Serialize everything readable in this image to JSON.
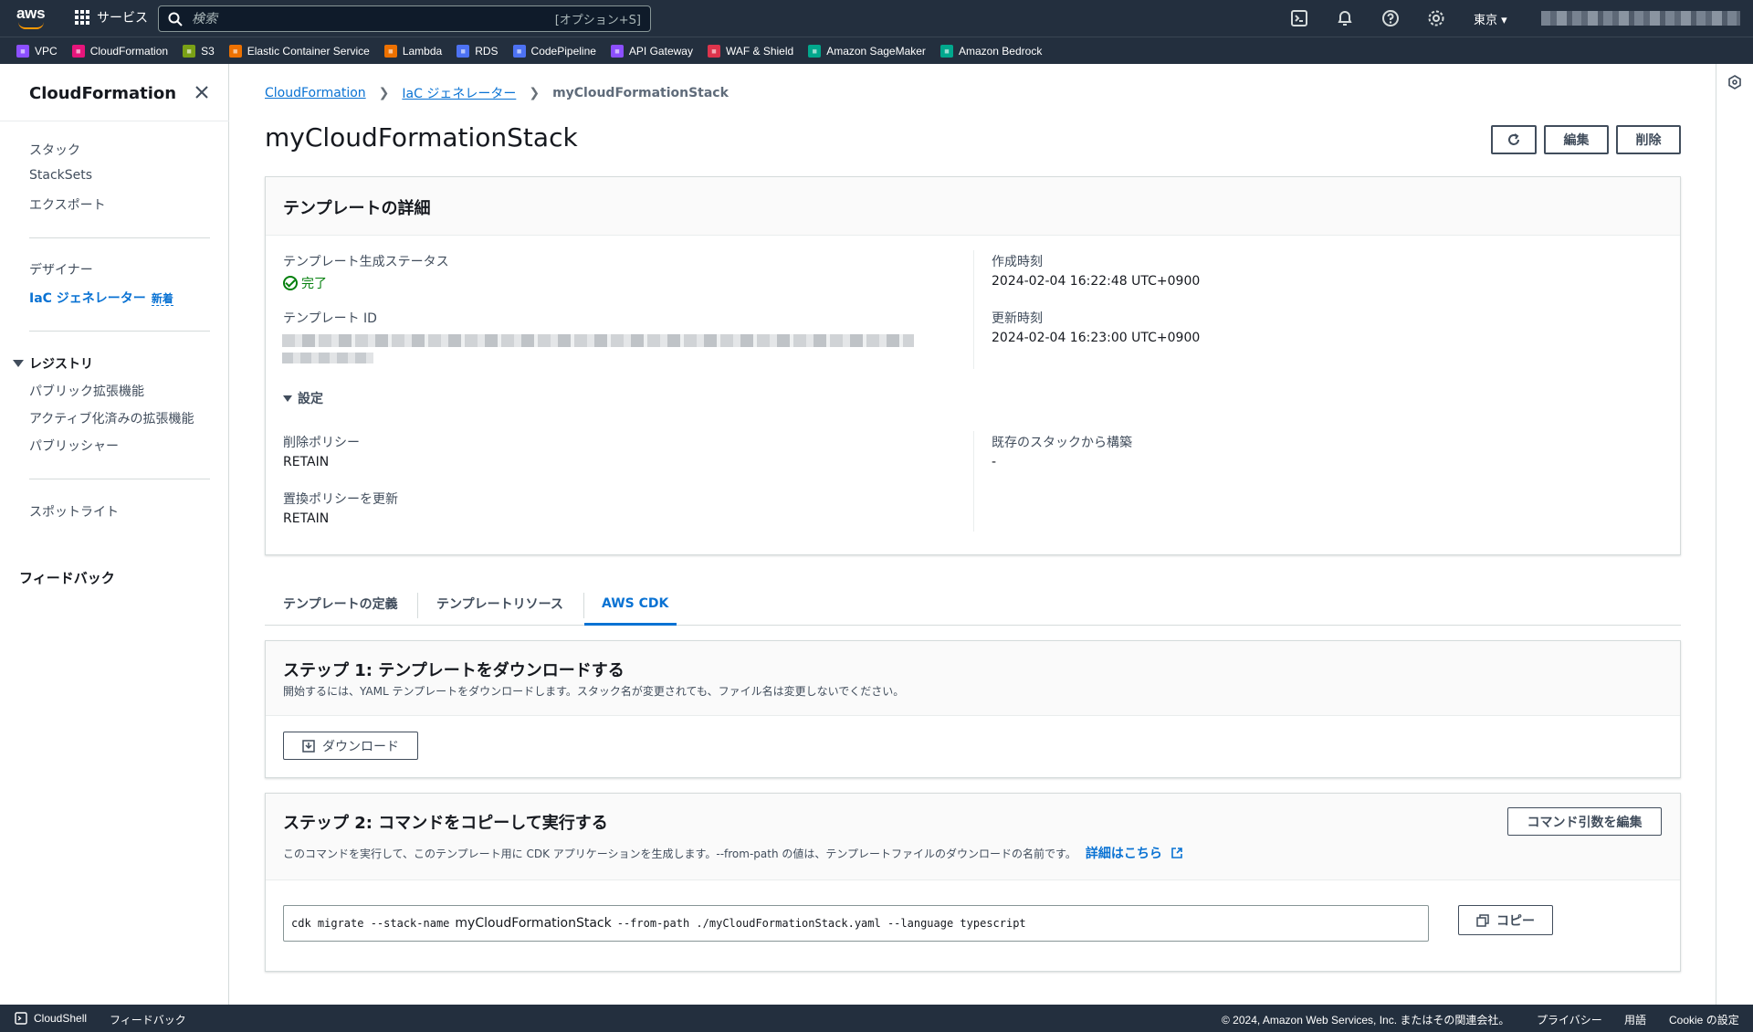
{
  "topnav": {
    "logo": "aws",
    "services_label": "サービス",
    "search_placeholder": "検索",
    "search_shortcut": "[オプション+S]",
    "region": "東京 ▾",
    "icons": [
      "cloudshell-icon",
      "bell-icon",
      "help-icon",
      "settings-icon"
    ]
  },
  "favorites": [
    {
      "label": "VPC",
      "color": "#8c4fff",
      "icon": "vpc-icon"
    },
    {
      "label": "CloudFormation",
      "color": "#e7157b",
      "icon": "cloudformation-icon"
    },
    {
      "label": "S3",
      "color": "#7aa116",
      "icon": "s3-icon"
    },
    {
      "label": "Elastic Container Service",
      "color": "#ed7100",
      "icon": "ecs-icon"
    },
    {
      "label": "Lambda",
      "color": "#ed7100",
      "icon": "lambda-icon"
    },
    {
      "label": "RDS",
      "color": "#4d72f3",
      "icon": "rds-icon"
    },
    {
      "label": "CodePipeline",
      "color": "#4d72f3",
      "icon": "codepipeline-icon"
    },
    {
      "label": "API Gateway",
      "color": "#8c4fff",
      "icon": "api-gateway-icon"
    },
    {
      "label": "WAF & Shield",
      "color": "#dd344c",
      "icon": "waf-icon"
    },
    {
      "label": "Amazon SageMaker",
      "color": "#01a88d",
      "icon": "sagemaker-icon"
    },
    {
      "label": "Amazon Bedrock",
      "color": "#01a88d",
      "icon": "bedrock-icon"
    }
  ],
  "sidebar": {
    "title": "CloudFormation",
    "items": [
      {
        "label": "スタック"
      },
      {
        "label": "StackSets"
      },
      {
        "label": "エクスポート"
      },
      {
        "label": "デザイナー"
      },
      {
        "label": "IaC ジェネレーター",
        "badge": "新着"
      },
      {
        "label": "パブリック拡張機能"
      },
      {
        "label": "アクティブ化済みの拡張機能"
      },
      {
        "label": "パブリッシャー"
      },
      {
        "label": "スポットライト"
      }
    ],
    "registry_label": "レジストリ",
    "feedback_label": "フィードバック"
  },
  "breadcrumb": [
    "CloudFormation",
    "IaC ジェネレーター",
    "myCloudFormationStack"
  ],
  "page": {
    "title": "myCloudFormationStack",
    "edit_label": "編集",
    "delete_label": "削除"
  },
  "details": {
    "title": "テンプレートの詳細",
    "status_label": "テンプレート生成ステータス",
    "status_value": "完了",
    "template_id_label": "テンプレート ID",
    "created_label": "作成時刻",
    "created_value": "2024-02-04 16:22:48 UTC+0900",
    "updated_label": "更新時刻",
    "updated_value": "2024-02-04 16:23:00 UTC+0900",
    "settings_label": "設定",
    "deletion_policy_label": "削除ポリシー",
    "deletion_policy_value": "RETAIN",
    "update_replace_label": "置換ポリシーを更新",
    "update_replace_value": "RETAIN",
    "from_stack_label": "既存のスタックから構築",
    "from_stack_value": "-"
  },
  "tabs": [
    {
      "label": "テンプレートの定義"
    },
    {
      "label": "テンプレートリソース"
    },
    {
      "label": "AWS CDK"
    }
  ],
  "step1": {
    "title": "ステップ 1: テンプレートをダウンロードする",
    "desc": "開始するには、YAML テンプレートをダウンロードします。スタック名が変更されても、ファイル名は変更しないでください。",
    "download_label": "ダウンロード"
  },
  "step2": {
    "title": "ステップ 2: コマンドをコピーして実行する",
    "desc": "このコマンドを実行して、このテンプレート用に CDK アプリケーションを生成します。--from-path の値は、テンプレートファイルのダウンロードの名前です。",
    "learn_more": "詳細はこちら",
    "edit_args_label": "コマンド引数を編集",
    "cmd_prefix": "cdk migrate --stack-name",
    "cmd_stack": "myCloudFormationStack",
    "cmd_suffix": "--from-path ./myCloudFormationStack.yaml --language typescript",
    "copy_label": "コピー"
  },
  "footer": {
    "cloudshell": "CloudShell",
    "feedback": "フィードバック",
    "copyright": "© 2024, Amazon Web Services, Inc. またはその関連会社。",
    "privacy": "プライバシー",
    "terms": "用語",
    "cookie": "Cookie の設定"
  }
}
